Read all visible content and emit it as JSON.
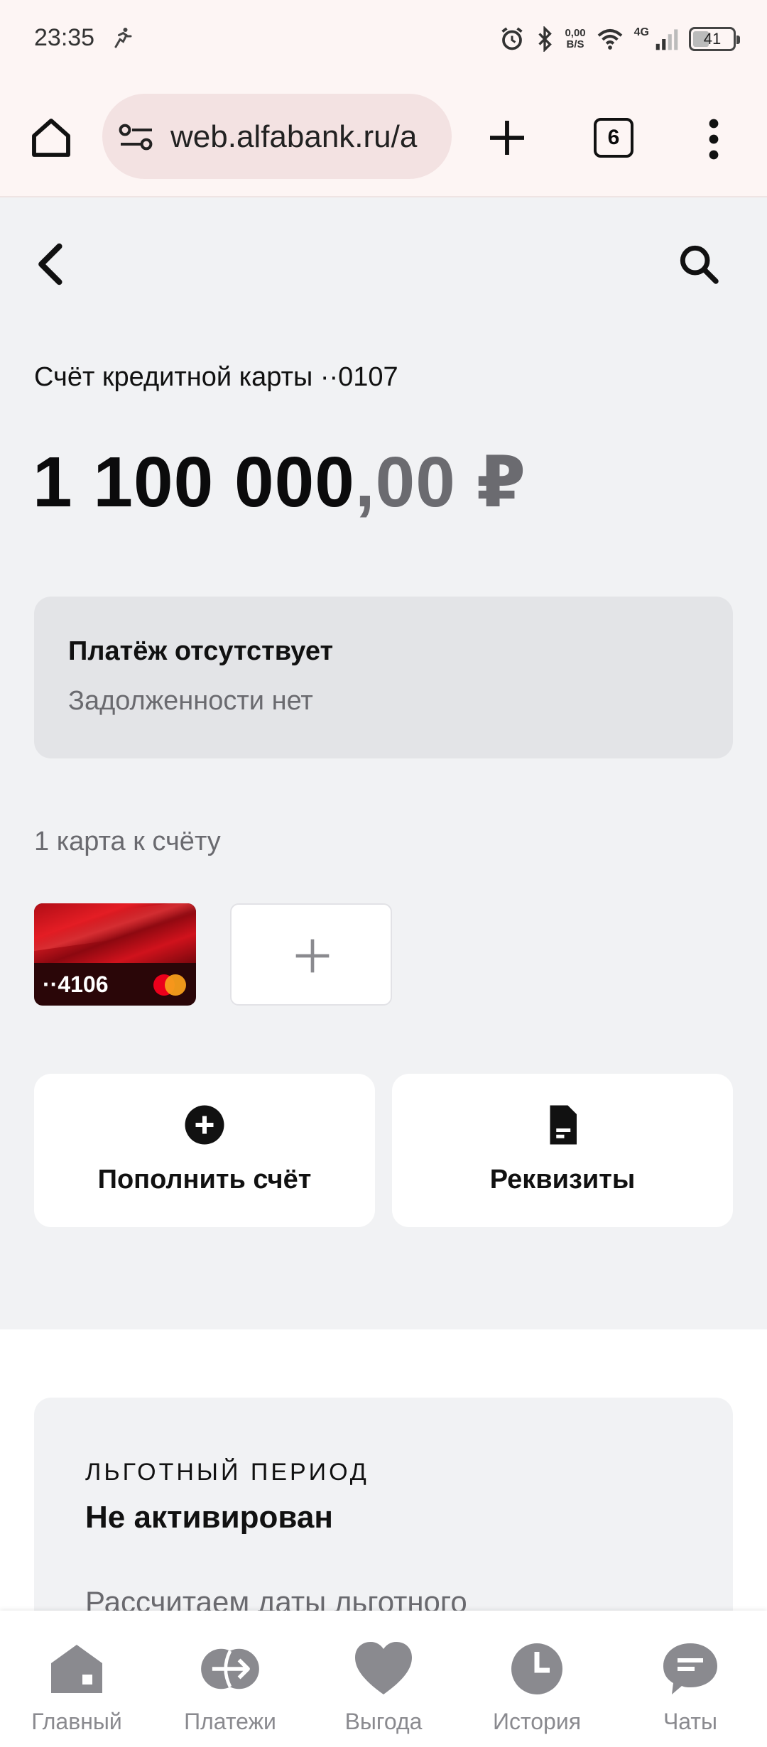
{
  "status_bar": {
    "time": "23:35",
    "net_rate_value": "0,00",
    "net_rate_unit": "B/S",
    "network": "4G",
    "battery": "41",
    "battery_level": 0.41
  },
  "browser": {
    "url": "web.alfabank.ru/a",
    "tab_count": "6"
  },
  "account": {
    "title": "Счёт кредитной карты ··0107",
    "balance_int": "1 100 000",
    "balance_frac": ",00 ₽"
  },
  "payment": {
    "title": "Платёж отсутствует",
    "subtitle": "Задолженности нет"
  },
  "cards": {
    "label": "1 карта к счёту",
    "items": [
      {
        "number": "··4106",
        "brand": "mastercard"
      }
    ]
  },
  "actions": {
    "topup": "Пополнить счёт",
    "details": "Реквизиты"
  },
  "grace_period": {
    "kicker": "ЛЬГОТНЫЙ ПЕРИОД",
    "title": "Не активирован",
    "text": "Рассчитаем даты льготного"
  },
  "nav": {
    "items": [
      {
        "label": "Главный",
        "icon": "home-icon"
      },
      {
        "label": "Платежи",
        "icon": "transfer-icon"
      },
      {
        "label": "Выгода",
        "icon": "heart-icon"
      },
      {
        "label": "История",
        "icon": "clock-icon"
      },
      {
        "label": "Чаты",
        "icon": "chat-icon"
      }
    ]
  },
  "colors": {
    "page_bg": "#f1f2f4",
    "browser_bg": "#fdf5f4",
    "muted_text": "#6a6a6f",
    "nav_icon": "#8a8a8f"
  }
}
